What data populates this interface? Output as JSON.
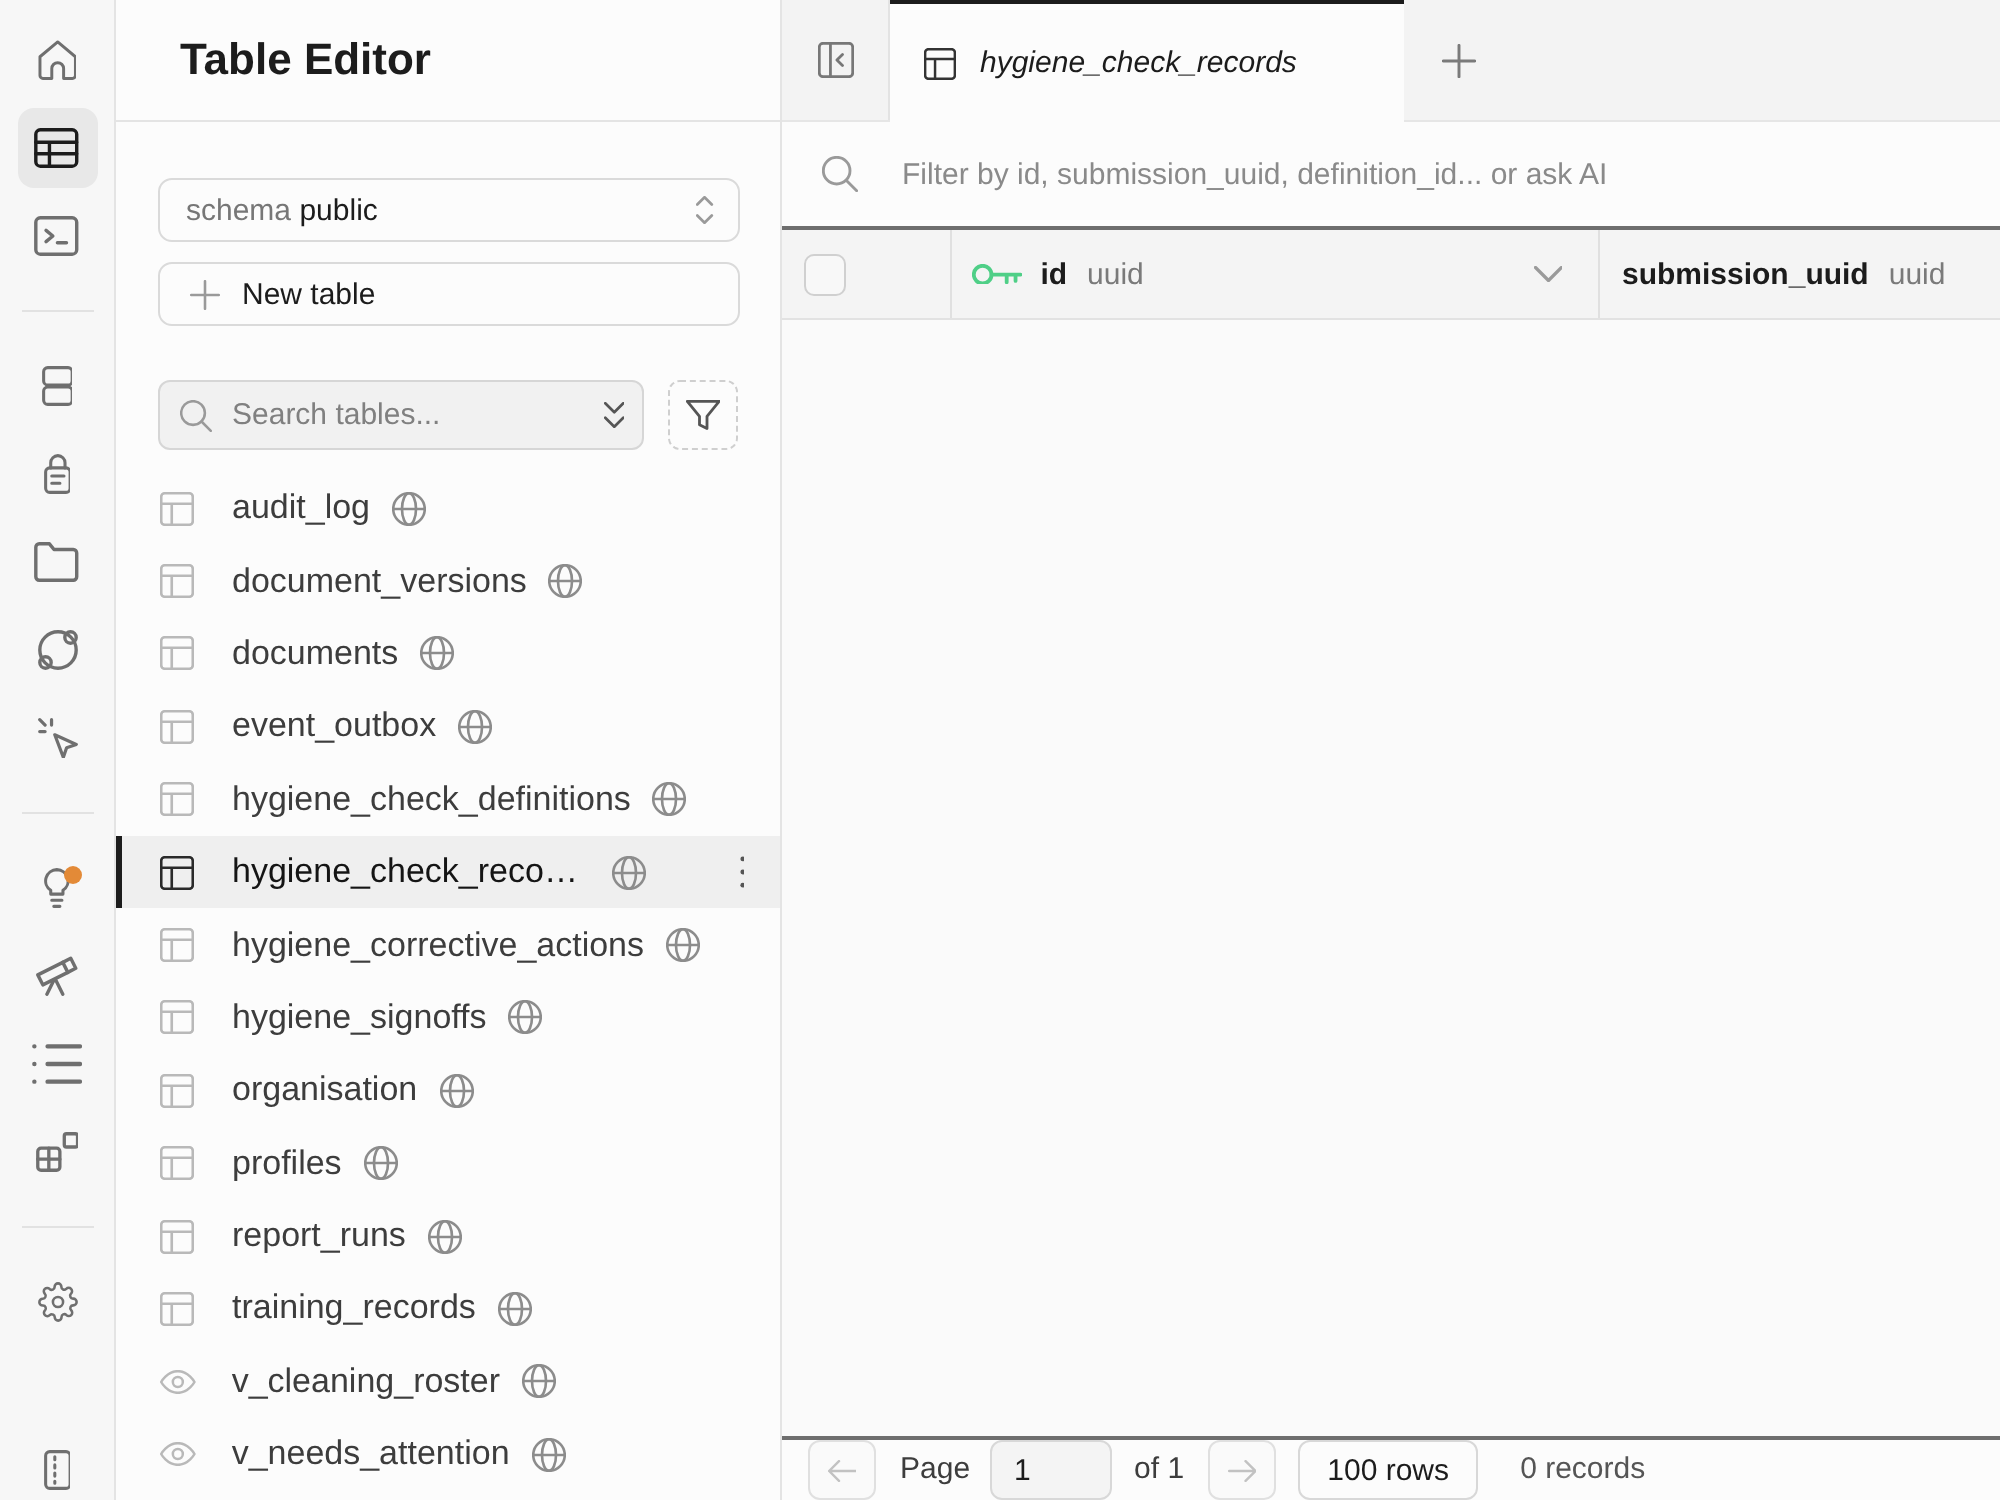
{
  "rail": {
    "groups": [
      {
        "items": [
          {
            "kind": "home",
            "selected": false,
            "badge": false
          },
          {
            "kind": "table",
            "selected": true,
            "badge": false
          },
          {
            "kind": "terminal",
            "selected": false,
            "badge": false
          }
        ]
      },
      {
        "items": [
          {
            "kind": "stack",
            "selected": false,
            "badge": false
          },
          {
            "kind": "lock",
            "selected": false,
            "badge": false
          },
          {
            "kind": "folder",
            "selected": false,
            "badge": false
          },
          {
            "kind": "orbit",
            "selected": false,
            "badge": false
          },
          {
            "kind": "cursor",
            "selected": false,
            "badge": false
          }
        ]
      },
      {
        "items": [
          {
            "kind": "lightbulb",
            "selected": false,
            "badge": true
          },
          {
            "kind": "telescope",
            "selected": false,
            "badge": false
          },
          {
            "kind": "list",
            "selected": false,
            "badge": false
          },
          {
            "kind": "blocks",
            "selected": false,
            "badge": false
          }
        ]
      },
      {
        "items": [
          {
            "kind": "gear",
            "selected": false,
            "badge": false
          }
        ]
      }
    ],
    "bottom_items": [
      {
        "kind": "panel",
        "selected": false,
        "badge": false
      }
    ]
  },
  "sidebar": {
    "title": "Table Editor",
    "schema": {
      "label": "schema",
      "value": "public"
    },
    "new_table": {
      "label": "New table"
    },
    "search": {
      "placeholder": "Search tables..."
    },
    "tables": [
      {
        "name": "audit_log",
        "kind": "table",
        "selected": false
      },
      {
        "name": "document_versions",
        "kind": "table",
        "selected": false
      },
      {
        "name": "documents",
        "kind": "table",
        "selected": false
      },
      {
        "name": "event_outbox",
        "kind": "table",
        "selected": false
      },
      {
        "name": "hygiene_check_definitions",
        "kind": "table",
        "selected": false
      },
      {
        "name": "hygiene_check_reco…",
        "kind": "table",
        "selected": true
      },
      {
        "name": "hygiene_corrective_actions",
        "kind": "table",
        "selected": false
      },
      {
        "name": "hygiene_signoffs",
        "kind": "table",
        "selected": false
      },
      {
        "name": "organisation",
        "kind": "table",
        "selected": false
      },
      {
        "name": "profiles",
        "kind": "table",
        "selected": false
      },
      {
        "name": "report_runs",
        "kind": "table",
        "selected": false
      },
      {
        "name": "training_records",
        "kind": "table",
        "selected": false
      },
      {
        "name": "v_cleaning_roster",
        "kind": "view",
        "selected": false
      },
      {
        "name": "v_needs_attention",
        "kind": "view",
        "selected": false
      }
    ]
  },
  "main": {
    "tabs": [
      {
        "label": "hygiene_check_records",
        "selected": true
      }
    ],
    "filter": {
      "placeholder": "Filter by id, submission_uuid, definition_id... or ask AI"
    },
    "grid": {
      "select_all": {
        "checked": false
      },
      "columns": [
        {
          "name": "id",
          "type": "uuid",
          "primary_key": true
        },
        {
          "name": "submission_uuid",
          "type": "uuid",
          "primary_key": false
        }
      ]
    },
    "pagination": {
      "previous": {
        "disabled": true
      },
      "page_label": "Page",
      "page": "1",
      "page_total": "of 1",
      "next": {
        "disabled": true
      },
      "page_size": "100 rows",
      "record_count": "0 records"
    }
  }
}
